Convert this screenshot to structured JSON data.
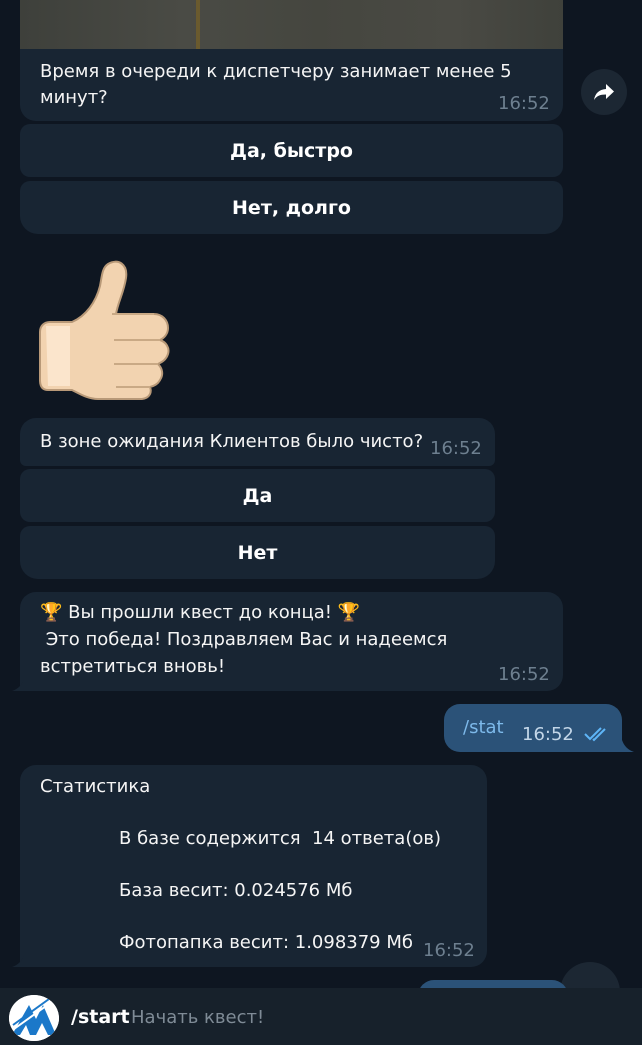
{
  "messages": {
    "queue_question": {
      "text_line1": "Время в очереди к диспетчеру занимает менее 5",
      "text_line2": "минут?",
      "time": "16:52"
    },
    "queue_buttons": [
      "Да, быстро",
      "Нет, долго"
    ],
    "clean_question": {
      "text": "В зоне ожидания Клиентов было чисто?",
      "time": "16:52"
    },
    "clean_buttons": [
      "Да",
      "Нет"
    ],
    "finish": {
      "line1": "🏆 Вы прошли квест до конца! 🏆",
      "line2": " Это победа! Поздравляем Вас и надеемся",
      "line3": "встретиться вновь!",
      "time": "16:52"
    },
    "user_stat": {
      "text": "/stat",
      "time": "16:52"
    },
    "stats": {
      "title": "Статистика",
      "line1": "В базе содержится  14 ответа(ов)",
      "line2": "База весит: 0.024576 Мб",
      "line3": "Фотопапка весит: 1.098379 Мб",
      "time": "16:52"
    }
  },
  "command_suggestion": {
    "command": "/start",
    "description": "Начать квест!"
  },
  "icons": {
    "forward": "forward-arrow-icon",
    "thumbs_up": "thumbs-up-sticker",
    "read_receipt": "double-check-icon",
    "bot_avatar": "bot-logo"
  },
  "colors": {
    "background": "#0e1621",
    "incoming": "#182533",
    "outgoing": "#2b5278",
    "accent": "#5eb5f7"
  }
}
